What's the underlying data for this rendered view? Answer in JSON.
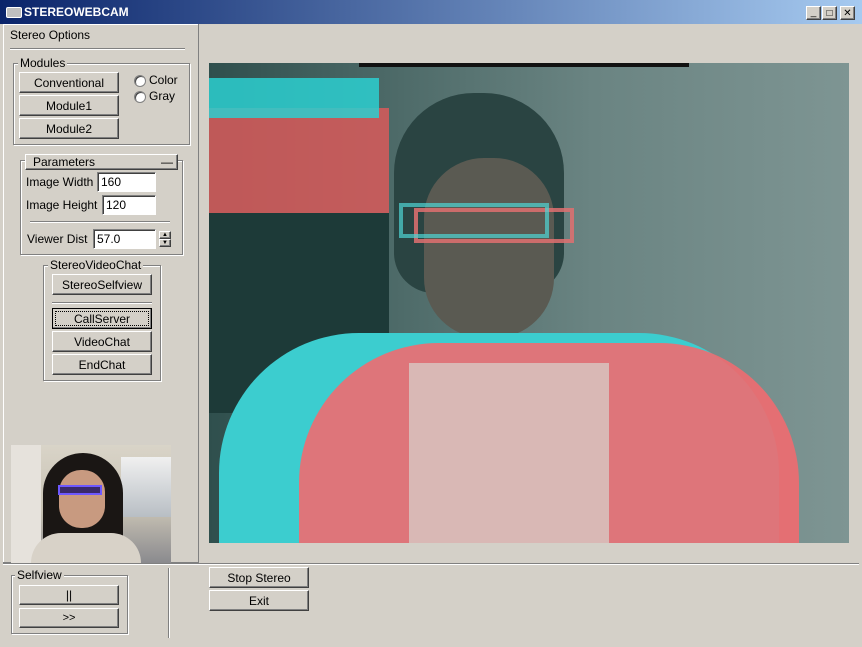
{
  "window": {
    "title": "STEREOWEBCAM",
    "controls": {
      "minimize": "_",
      "maximize": "□",
      "close": "✕"
    }
  },
  "left_panel": {
    "title": "Stereo Options",
    "modules": {
      "title": "Modules",
      "buttons": [
        "Conventional",
        "Module1",
        "Module2"
      ],
      "radios": [
        "Color",
        "Gray"
      ]
    },
    "parameters": {
      "title": "Parameters",
      "collapse": "—",
      "image_width_label": "Image Width",
      "image_width_value": "160",
      "image_height_label": "Image Height",
      "image_height_value": "120",
      "viewer_dist_label": "Viewer Dist",
      "viewer_dist_value": "57.0"
    },
    "videochat": {
      "title": "StereoVideoChat",
      "buttons": [
        "StereoSelfview",
        "CallServer",
        "VideoChat",
        "EndChat"
      ]
    }
  },
  "selfview": {
    "title": "Selfview",
    "pause_label": "||",
    "forward_label": ">>"
  },
  "bottom_buttons": {
    "stop_stereo": "Stop Stereo",
    "exit": "Exit"
  },
  "colors": {
    "titlebar_start": "#0a246a",
    "titlebar_end": "#a6caf0",
    "panel": "#d4d0c8",
    "anaglyph_cyan": "#2ecfd0",
    "anaglyph_red": "#f05a60"
  }
}
